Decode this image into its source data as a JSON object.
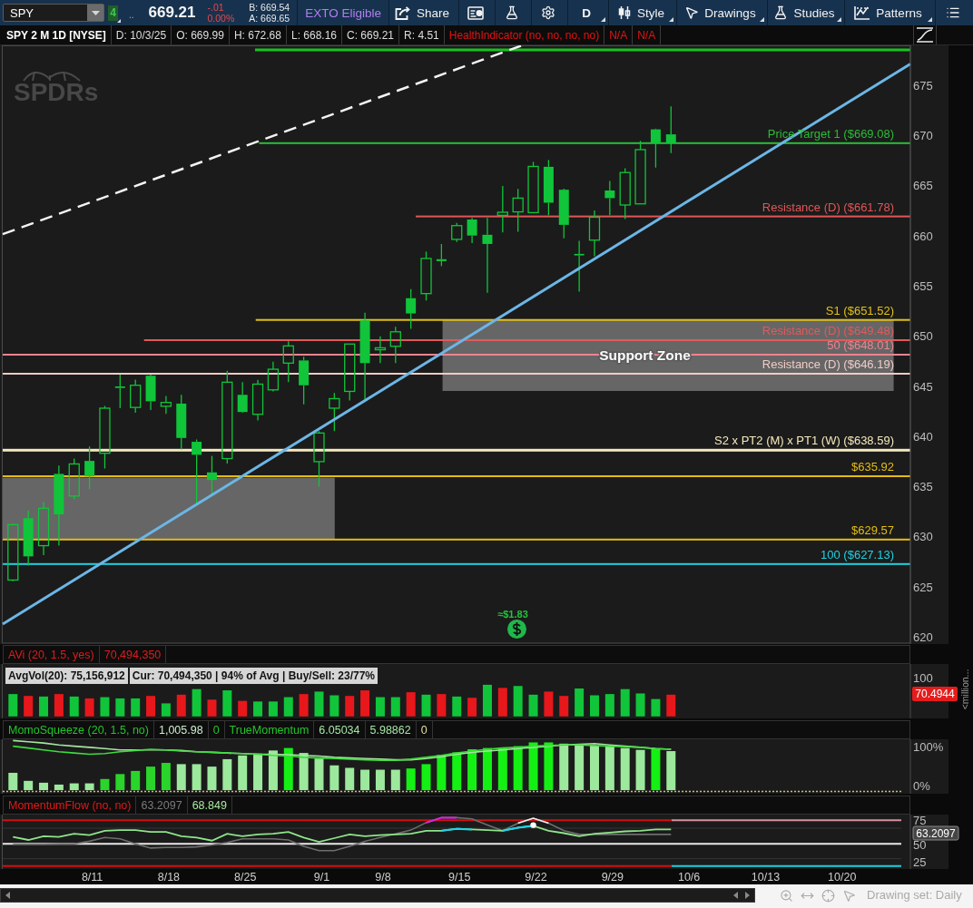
{
  "toolbar": {
    "symbol": "SPY",
    "badge": "4",
    "more": "..",
    "last_price": "669.21",
    "net_change": "-.01",
    "percent_change": "0.00%",
    "bid": "B: 669.54",
    "ask": "A: 669.65",
    "exto": "EXTO Eligible",
    "buttons": [
      {
        "kind": "share",
        "label": "Share",
        "dropdown": false
      },
      {
        "kind": "alert",
        "dropdown": false
      },
      {
        "kind": "lab",
        "dropdown": false
      },
      {
        "kind": "gear",
        "dropdown": false
      },
      {
        "kind": "text",
        "label": "D",
        "dropdown": true
      },
      {
        "kind": "style",
        "label": "Style",
        "dropdown": true
      },
      {
        "kind": "drawings",
        "label": "Drawings",
        "dropdown": true
      },
      {
        "kind": "studies",
        "label": "Studies",
        "dropdown": true
      },
      {
        "kind": "patterns",
        "label": "Patterns",
        "dropdown": true
      },
      {
        "kind": "menu",
        "dropdown": false
      }
    ]
  },
  "info_bar": {
    "title": "SPY 2 M 1D [NYSE]",
    "fields": [
      "D: 10/3/25",
      "O: 669.99",
      "H: 672.68",
      "L: 668.16",
      "C: 669.21",
      "R: 4.51"
    ],
    "indicators": [
      "HealthIndicator (no, no, no, no)",
      "N/A",
      "N/A"
    ]
  },
  "price_chart": {
    "logo": "SPDRs",
    "levels": [
      {
        "color": "#16c41c"
      },
      {
        "label": "Price Target 1 ($669.08)",
        "color": "#2cbc38"
      },
      {
        "label": "Resistance (D) ($661.78)",
        "color": "#e05656"
      },
      {
        "label": "S1 ($651.52)",
        "color": "#e2c11a"
      },
      {
        "label": "Resistance (D) ($649.48)",
        "color": "#e05a5a"
      },
      {
        "label": "50 ($648.01)",
        "color": "#ec8490"
      },
      {
        "label": "Resistance (D) ($646.19)",
        "color": "#f0cbc6"
      },
      {
        "label": "S2 x PT2 (M) x PT1 (W) ($638.59)",
        "color": "#f4e8bc"
      },
      {
        "label": "$635.92",
        "color": "#e5bc12"
      },
      {
        "label": "$629.57",
        "color": "#e5bc12"
      },
      {
        "label": "100 ($627.13)",
        "color": "#1fd2e0"
      }
    ],
    "zone_label": "Support Zone",
    "dividend": "≈$1.83",
    "y_ticks": [
      "675",
      "670",
      "665",
      "660",
      "655",
      "650",
      "645",
      "640",
      "635",
      "630",
      "625",
      "620"
    ]
  },
  "volume_pane": {
    "header": [
      {
        "text": "AVi (20, 1.5, yes)",
        "color": "#e31a1a"
      },
      {
        "text": "70,494,350",
        "color": "#e31a1a"
      }
    ],
    "summary": [
      "AvgVol(20): 75,156,912",
      "Cur: 70,494,350 | 94% of Avg | Buy/Sell: 23/77%"
    ],
    "y_tick": "100",
    "last_value": "70.4944",
    "unit": "<million..."
  },
  "squeeze_pane": {
    "header": [
      {
        "text": "MomoSqueeze (20, 1.5, no)",
        "color": "#22c42a"
      },
      {
        "text": "1,005.98",
        "color": "#cdeccd"
      },
      {
        "text": "0",
        "color": "#22c42a"
      },
      {
        "text": "TrueMomentum",
        "color": "#22c42a"
      },
      {
        "text": "6.05034",
        "color": "#a4e4a4"
      },
      {
        "text": "5.98862",
        "color": "#a4e4a4"
      },
      {
        "text": "0",
        "color": "#e6dfa0"
      }
    ],
    "y_ticks": [
      "100%",
      "0%"
    ]
  },
  "flow_pane": {
    "header": [
      {
        "text": "MomentumFlow (no, no)",
        "color": "#e01a1a"
      },
      {
        "text": "63.2097",
        "color": "#7a7a7a"
      },
      {
        "text": "68.849",
        "color": "#a8e6a0"
      }
    ],
    "y_ticks": [
      "75",
      "50",
      "25"
    ],
    "last_value": "63.2097"
  },
  "x_axis": {
    "labels": [
      "8/11",
      "8/18",
      "8/25",
      "9/1",
      "9/8",
      "9/15",
      "9/22",
      "9/29",
      "10/6",
      "10/13",
      "10/20"
    ]
  },
  "status_bar": {
    "drawing_set": "Drawing set: Daily"
  }
}
